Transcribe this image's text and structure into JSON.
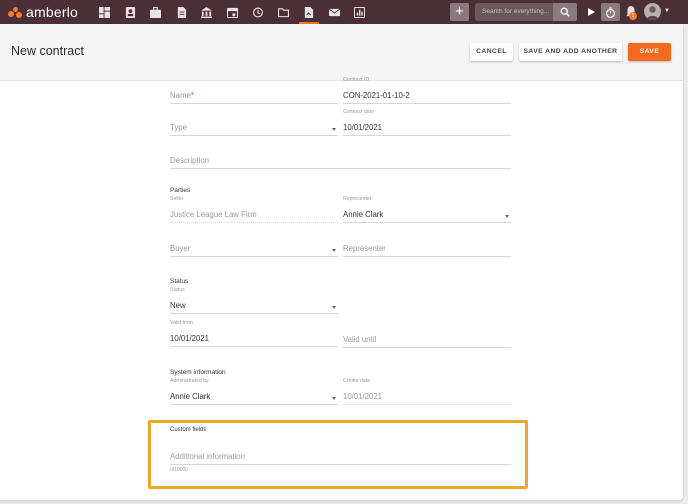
{
  "app": {
    "name": "amberlo",
    "brand_color": "#f47b2a",
    "topbar_color": "#4a2f37"
  },
  "topbar": {
    "nav_icons": [
      "dashboard-icon",
      "contacts-icon",
      "matters-icon",
      "documents-icon",
      "institutions-icon",
      "calendar-icon",
      "history-icon",
      "folder-icon",
      "contract-icon",
      "mail-icon",
      "reports-icon"
    ],
    "active_icon": "contract-icon",
    "search_placeholder": "Search for everything...",
    "notification_count": "1"
  },
  "header": {
    "title": "New contract",
    "cancel_label": "CANCEL",
    "save_add_label": "SAVE AND ADD ANOTHER",
    "save_label": "SAVE"
  },
  "form": {
    "name_placeholder": "Name",
    "contract_id_label": "Contract ID",
    "contract_id_value": "CON-2021-01-10-2",
    "type_placeholder": "Type",
    "contract_date_label": "Contract date",
    "contract_date_value": "10/01/2021",
    "description_placeholder": "Description",
    "parties_title": "Parties",
    "seller_label": "Seller",
    "seller_value": "Justice League Law Firm",
    "seller_representer_label": "Representer",
    "seller_representer_value": "Annie Clark",
    "buyer_placeholder": "Buyer",
    "buyer_representer_placeholder": "Representer",
    "status_title": "Status",
    "status_label": "Status",
    "status_value": "New",
    "valid_from_label": "Valid from",
    "valid_from_value": "10/01/2021",
    "valid_until_placeholder": "Valid until",
    "system_title": "System information",
    "administrated_label": "Administrated by",
    "administrated_value": "Annie Clark",
    "create_date_label": "Create date",
    "create_date_value": "10/01/2021",
    "custom_title": "Custom fields",
    "additional_placeholder": "Additional information",
    "additional_counter": "0/10000"
  }
}
